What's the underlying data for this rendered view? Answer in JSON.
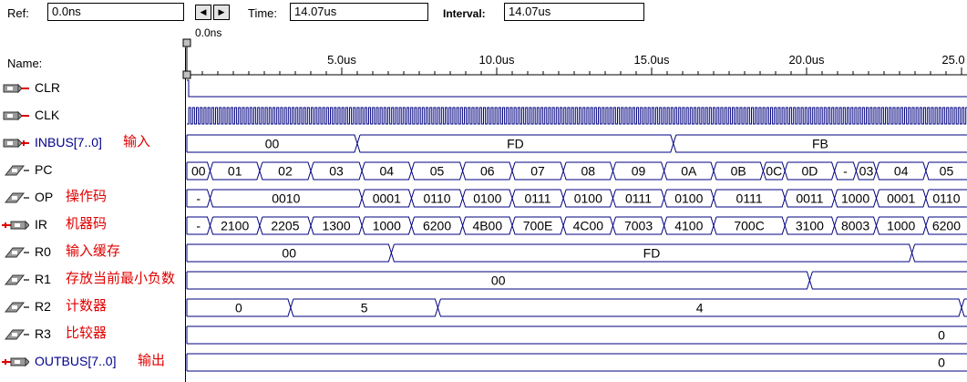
{
  "toolbar": {
    "ref_label": "Ref:",
    "ref_value": "0.0ns",
    "time_label": "Time:",
    "time_value": "14.07us",
    "interval_label": "Interval:",
    "interval_value": "14.07us",
    "nav_left_icon": "arrow-left-icon",
    "nav_right_icon": "arrow-right-icon"
  },
  "cursor_label": "0.0ns",
  "name_header": "Name:",
  "ruler": {
    "ticks": [
      "5.0us",
      "10.0us",
      "15.0us",
      "20.0us",
      "25.0"
    ]
  },
  "signals": [
    {
      "name": "CLR",
      "note": "",
      "icon": "input-pin-icon",
      "color_blue": false
    },
    {
      "name": "CLK",
      "note": "",
      "icon": "input-pin-icon",
      "color_blue": false
    },
    {
      "name": "INBUS[7..0]",
      "note": "输入",
      "icon": "input-bus-icon",
      "color_blue": true
    },
    {
      "name": "PC",
      "note": "",
      "icon": "node-icon",
      "color_blue": false
    },
    {
      "name": "OP",
      "note": "操作码",
      "icon": "node-icon",
      "color_blue": false
    },
    {
      "name": "IR",
      "note": "机器码",
      "icon": "output-bus-icon",
      "color_blue": false
    },
    {
      "name": "R0",
      "note": "输入缓存",
      "icon": "node-icon",
      "color_blue": false
    },
    {
      "name": "R1",
      "note": "存放当前最小负数",
      "icon": "node-icon",
      "color_blue": false
    },
    {
      "name": "R2",
      "note": "计数器",
      "icon": "node-icon",
      "color_blue": false
    },
    {
      "name": "R3",
      "note": "比较器",
      "icon": "node-icon",
      "color_blue": false
    },
    {
      "name": "OUTBUS[7..0]",
      "note": "输出",
      "icon": "output-bus-icon",
      "color_blue": true
    }
  ],
  "waves": {
    "clr": {
      "high_until_us": 0.0
    },
    "inbus": {
      "transitions_us": [
        0,
        5.5,
        15.7,
        30
      ],
      "values": [
        "00",
        "FD",
        "FB"
      ]
    },
    "pc": {
      "transitions_us": [
        0,
        0.75,
        2.35,
        4.0,
        5.65,
        7.25,
        8.9,
        10.5,
        12.15,
        13.75,
        15.4,
        17.0,
        18.6,
        19.3,
        20.9,
        21.6,
        22.25,
        23.85,
        30
      ],
      "values": [
        "00",
        "01",
        "02",
        "03",
        "04",
        "05",
        "06",
        "07",
        "08",
        "09",
        "0A",
        "0B",
        "0C",
        "0D",
        "-",
        "03",
        "04",
        "05"
      ]
    },
    "op": {
      "transitions_us": [
        0,
        0.75,
        5.65,
        7.25,
        8.9,
        10.5,
        12.15,
        13.75,
        15.4,
        17.0,
        19.3,
        20.9,
        22.25,
        23.85,
        30
      ],
      "values": [
        "-",
        "0010",
        "0001",
        "0110",
        "0100",
        "0111",
        "0100",
        "0111",
        "0100",
        "0111",
        "0011",
        "1000",
        "0001",
        "0110"
      ]
    },
    "ir": {
      "transitions_us": [
        0,
        0.75,
        2.35,
        4.0,
        5.65,
        7.25,
        8.9,
        10.5,
        12.15,
        13.75,
        15.4,
        17.0,
        19.3,
        20.9,
        22.25,
        23.85,
        30
      ],
      "values": [
        "-",
        "2100",
        "2205",
        "1300",
        "1000",
        "6200",
        "4B00",
        "700E",
        "4C00",
        "7003",
        "4100",
        "700C",
        "3100",
        "8003",
        "1000",
        "6200"
      ]
    },
    "r0": {
      "transitions_us": [
        0,
        6.6,
        23.4,
        30
      ],
      "values": [
        "00",
        "FD",
        ""
      ]
    },
    "r1": {
      "transitions_us": [
        0,
        20.1,
        30
      ],
      "values": [
        "00",
        ""
      ]
    },
    "r2": {
      "transitions_us": [
        0,
        3.35,
        8.1,
        25.0,
        30
      ],
      "values": [
        "0",
        "5",
        "4",
        ""
      ]
    },
    "r3": {
      "transitions_us": [
        0,
        30
      ],
      "values": [
        "0"
      ]
    },
    "outbus": {
      "transitions_us": [
        0,
        30
      ],
      "values": [
        "0"
      ]
    }
  },
  "colors": {
    "wave": "#000080",
    "note_red": "#e00000",
    "bus_name_blue": "#00008b"
  }
}
